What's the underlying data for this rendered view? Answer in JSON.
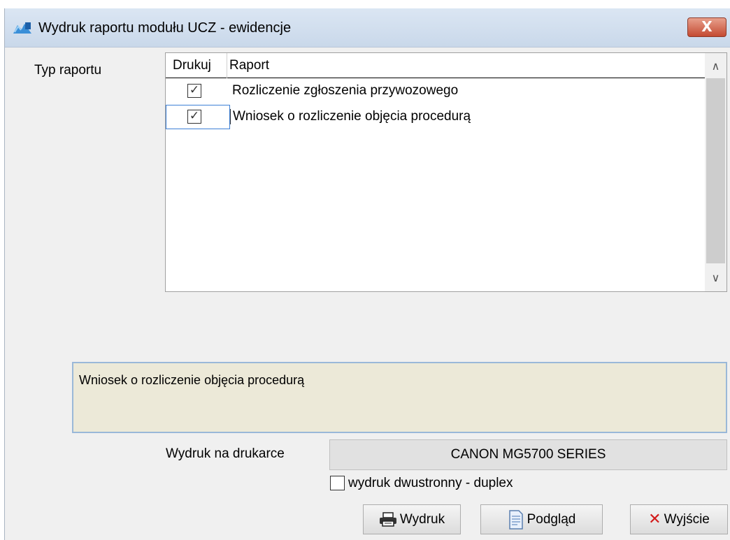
{
  "window": {
    "title": "Wydruk raportu modułu UCZ - ewidencje",
    "close_label": "X"
  },
  "report_type": {
    "label": "Typ raportu",
    "columns": [
      "Drukuj",
      "Raport"
    ],
    "rows": [
      {
        "checked": true,
        "name": "Rozliczenie zgłoszenia przywozowego"
      },
      {
        "checked": true,
        "name": "Wniosek o rozliczenie objęcia procedurą"
      }
    ]
  },
  "description": {
    "text": "Wniosek o rozliczenie objęcia procedurą"
  },
  "printer": {
    "label": "Wydruk na drukarce",
    "value": "CANON MG5700 SERIES"
  },
  "duplex": {
    "checked": false,
    "label": "wydruk dwustronny - duplex"
  },
  "buttons": {
    "print": "Wydruk",
    "preview": "Podgląd",
    "exit": "Wyjście"
  },
  "checkmark": "✓",
  "icons": [
    "app-icon",
    "close-icon",
    "printer-icon",
    "preview-document-icon",
    "exit-x-icon",
    "scroll-up-icon",
    "scroll-down-icon"
  ]
}
